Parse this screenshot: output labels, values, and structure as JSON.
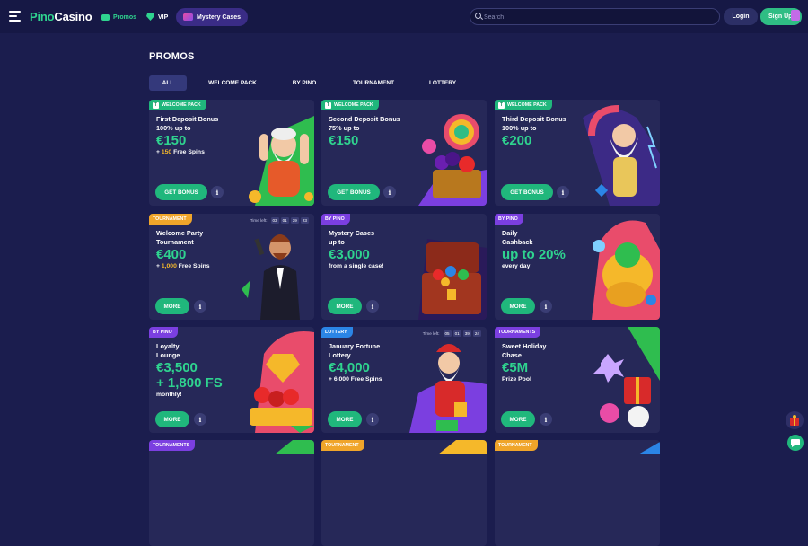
{
  "header": {
    "logo_part1": "Pino",
    "logo_part2": "Casino",
    "nav": [
      {
        "label": "Promos",
        "icon": "gift-box-icon",
        "color": "#2fd38f"
      },
      {
        "label": "VIP",
        "icon": "diamond-icon"
      },
      {
        "label": "Mystery Cases",
        "icon": "mystery-case-icon"
      }
    ],
    "search_placeholder": "Search",
    "login_label": "Login",
    "signup_label": "Sign Up"
  },
  "page_title": "PROMOS",
  "tabs": [
    "ALL",
    "WELCOME PACK",
    "BY PINO",
    "TOURNAMENT",
    "LOTTERY"
  ],
  "active_tab": "ALL",
  "timer_label": "Time left:",
  "cards": [
    {
      "badge": "WELCOME PACK",
      "badge_type": "welcome",
      "title": "First Deposit Bonus\n100% up to",
      "amount": "€150",
      "sub_pre": "+ ",
      "sub_hl": "150",
      "sub_post": " Free Spins",
      "button": "GET BONUS",
      "art": "santa-muscle-art"
    },
    {
      "badge": "WELCOME PACK",
      "badge_type": "welcome",
      "title": "Second Deposit Bonus\n75% up to",
      "amount": "€150",
      "sub_pre": "",
      "sub_hl": "",
      "sub_post": "",
      "button": "GET BONUS",
      "art": "candy-fruit-chest-art"
    },
    {
      "badge": "WELCOME PACK",
      "badge_type": "welcome",
      "title": "Third Deposit Bonus\n100% up to",
      "amount": "€200",
      "sub_pre": "",
      "sub_hl": "",
      "sub_post": "",
      "button": "GET BONUS",
      "art": "zeus-art"
    },
    {
      "badge": "TOURNAMENT",
      "badge_type": "tourn",
      "title": "Welcome Party\nTournament",
      "amount": "€400",
      "sub_pre": "+ ",
      "sub_hl": "1,000",
      "sub_post": " Free Spins",
      "button": "MORE",
      "art": "host-with-mic-art",
      "timer": [
        "03",
        "01",
        "39",
        "23"
      ]
    },
    {
      "badge": "BY PINO",
      "badge_type": "pino",
      "title": "Mystery Cases\nup to",
      "amount": "€3,000",
      "sub_pre": "from a single case!",
      "sub_hl": "",
      "sub_post": "",
      "button": "MORE",
      "art": "treasure-chest-art"
    },
    {
      "badge": "BY PINO",
      "badge_type": "pino",
      "title": "Daily\nCashback",
      "amount": "up to 20%",
      "sub_pre": "every day!",
      "sub_hl": "",
      "sub_post": "",
      "button": "MORE",
      "art": "gold-pot-art"
    },
    {
      "badge": "BY PINO",
      "badge_type": "pino",
      "title": "Loyalty\nLounge",
      "amount": "€3,500\n+ 1,800 FS",
      "sub_pre": "monthly!",
      "sub_hl": "",
      "sub_post": "",
      "button": "MORE",
      "art": "bonus-fruit-art"
    },
    {
      "badge": "LOTTERY",
      "badge_type": "lottery",
      "title": "January Fortune\nLottery",
      "amount": "€4,000",
      "sub_pre": "+ 6,000 Free Spins",
      "sub_hl": "",
      "sub_post": "",
      "button": "MORE",
      "art": "santa-winter-art",
      "timer": [
        "05",
        "01",
        "39",
        "24"
      ]
    },
    {
      "badge": "TOURNAMENTS",
      "badge_type": "pino",
      "title": "Sweet Holiday\nChase",
      "amount": "€5M",
      "sub_pre": "Prize Pool",
      "sub_hl": "",
      "sub_post": "",
      "button": "MORE",
      "art": "holiday-gifts-art"
    },
    {
      "badge": "TOURNAMENTS",
      "badge_type": "pino"
    },
    {
      "badge": "TOURNAMENT",
      "badge_type": "tourn"
    },
    {
      "badge": "TOURNAMENT",
      "badge_type": "tourn"
    }
  ]
}
